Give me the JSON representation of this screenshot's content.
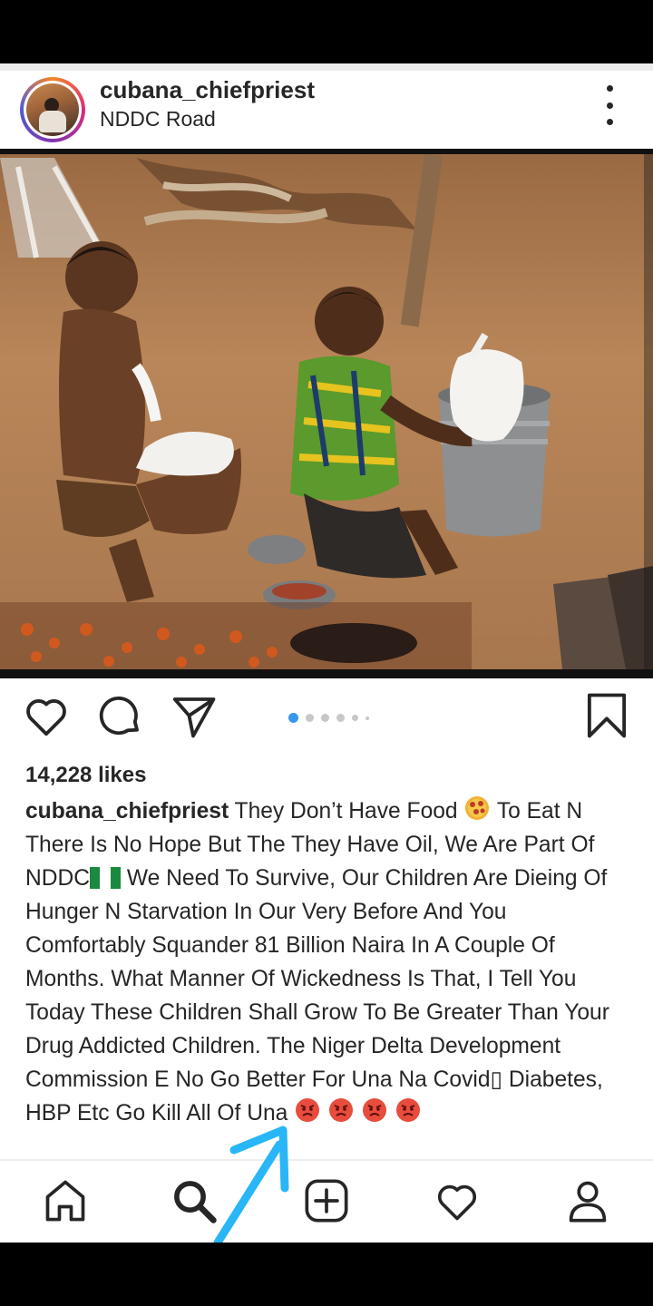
{
  "post": {
    "username": "cubana_chiefpriest",
    "location": "NDDC Road",
    "likes": "14,228 likes",
    "caption_username": "cubana_chiefpriest",
    "caption_part1": "They Don’t Have Food",
    "caption_part2": "To Eat N There Is No Hope But The They Have Oil, We Are Part Of NDDC",
    "caption_part3": "We Need To Survive, Our Children Are Dieing Of Hunger N Starvation In Our Very Before And You Comfortably Squander 81 Billion Naira In A Couple Of Months. What Manner Of Wickedness Is That, I Tell You Today These Children Shall Grow To Be Greater Than Your Drug Addicted Children. The Niger Delta Development Commission E No Go Better For Una Na Covid▯ Diabetes, HBP Etc Go Kill All Of Una",
    "carousel": {
      "count": 6,
      "active": 0
    }
  },
  "icons": {
    "more": "more-vertical-icon",
    "like": "heart-icon",
    "comment": "comment-icon",
    "share": "send-icon",
    "save": "bookmark-icon",
    "nav": [
      "home-icon",
      "search-icon",
      "add-post-icon",
      "activity-heart-icon",
      "profile-icon"
    ]
  },
  "colors": {
    "accent": "#3897f0",
    "text": "#262626",
    "annotation_arrow": "#29b6f6"
  }
}
